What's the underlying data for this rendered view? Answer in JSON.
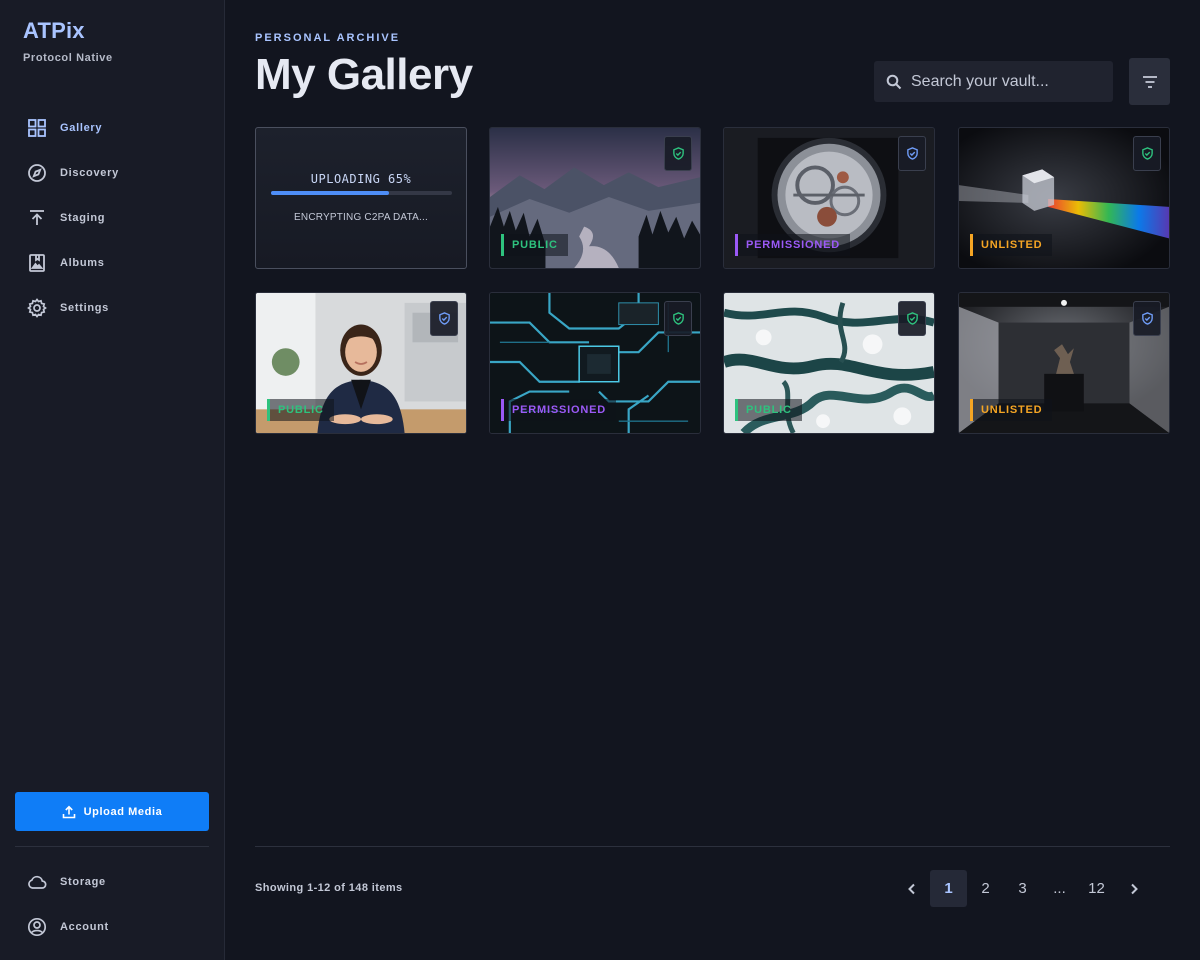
{
  "sidebar": {
    "brand_name": "ATPix",
    "brand_sub": "Protocol Native",
    "items": [
      {
        "label": "Gallery",
        "icon": "grid-icon",
        "active": true
      },
      {
        "label": "Discovery",
        "icon": "compass-icon"
      },
      {
        "label": "Staging",
        "icon": "upload-arrow-icon"
      },
      {
        "label": "Albums",
        "icon": "album-icon"
      },
      {
        "label": "Settings",
        "icon": "gear-icon"
      }
    ],
    "upload_label": "Upload Media",
    "bottom_items": [
      {
        "label": "Storage",
        "icon": "cloud-icon"
      },
      {
        "label": "Account",
        "icon": "account-icon"
      }
    ]
  },
  "header": {
    "eyebrow": "PERSONAL ARCHIVE",
    "title": "My Gallery",
    "search_placeholder": "Search your vault..."
  },
  "upload_card": {
    "title": "UPLOADING 65%",
    "progress": 0.65,
    "subtitle": "ENCRYPTING C2PA DATA..."
  },
  "gallery": [
    {
      "name": "mountain-lake",
      "visibility": "PUBLIC",
      "shield": "green"
    },
    {
      "name": "watch-movement",
      "visibility": "PERMISSIONED",
      "shield": "blue"
    },
    {
      "name": "glass-prism",
      "visibility": "UNLISTED",
      "shield": "green"
    },
    {
      "name": "businesswoman-portrait",
      "visibility": "PUBLIC",
      "shield": "blue"
    },
    {
      "name": "circuit-board",
      "visibility": "PERMISSIONED",
      "shield": "green"
    },
    {
      "name": "frozen-river",
      "visibility": "PUBLIC",
      "shield": "green"
    },
    {
      "name": "gallery-sculpture",
      "visibility": "UNLISTED",
      "shield": "blue"
    }
  ],
  "footer": {
    "showing": "Showing 1-12 of 148 items",
    "pages": [
      "1",
      "2",
      "3",
      "...",
      "12"
    ],
    "current_page": "1"
  },
  "colors": {
    "accent": "#a9c4ff",
    "primary_button": "#0f7df7",
    "public": "#2ec27e",
    "permissioned": "#9b59f6",
    "unlisted": "#f5a524"
  }
}
